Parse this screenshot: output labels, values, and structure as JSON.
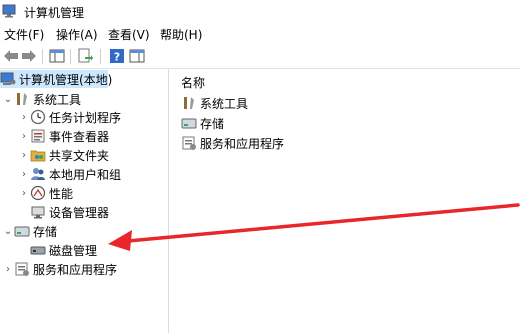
{
  "window": {
    "title": "计算机管理"
  },
  "menu": [
    {
      "label": "文件(F)"
    },
    {
      "label": "操作(A)"
    },
    {
      "label": "查看(V)"
    },
    {
      "label": "帮助(H)"
    }
  ],
  "tree": {
    "root": "计算机管理(本地)",
    "system_tools": "系统工具",
    "task_scheduler": "任务计划程序",
    "event_viewer": "事件查看器",
    "shared_folders": "共享文件夹",
    "local_users": "本地用户和组",
    "performance": "性能",
    "device_manager": "设备管理器",
    "storage": "存储",
    "disk_management": "磁盘管理",
    "services_apps": "服务和应用程序"
  },
  "list": {
    "header": "名称",
    "items": [
      {
        "label": "系统工具"
      },
      {
        "label": "存储"
      },
      {
        "label": "服务和应用程序"
      }
    ]
  },
  "annotation": {
    "arrow_color": "#e8262b"
  }
}
